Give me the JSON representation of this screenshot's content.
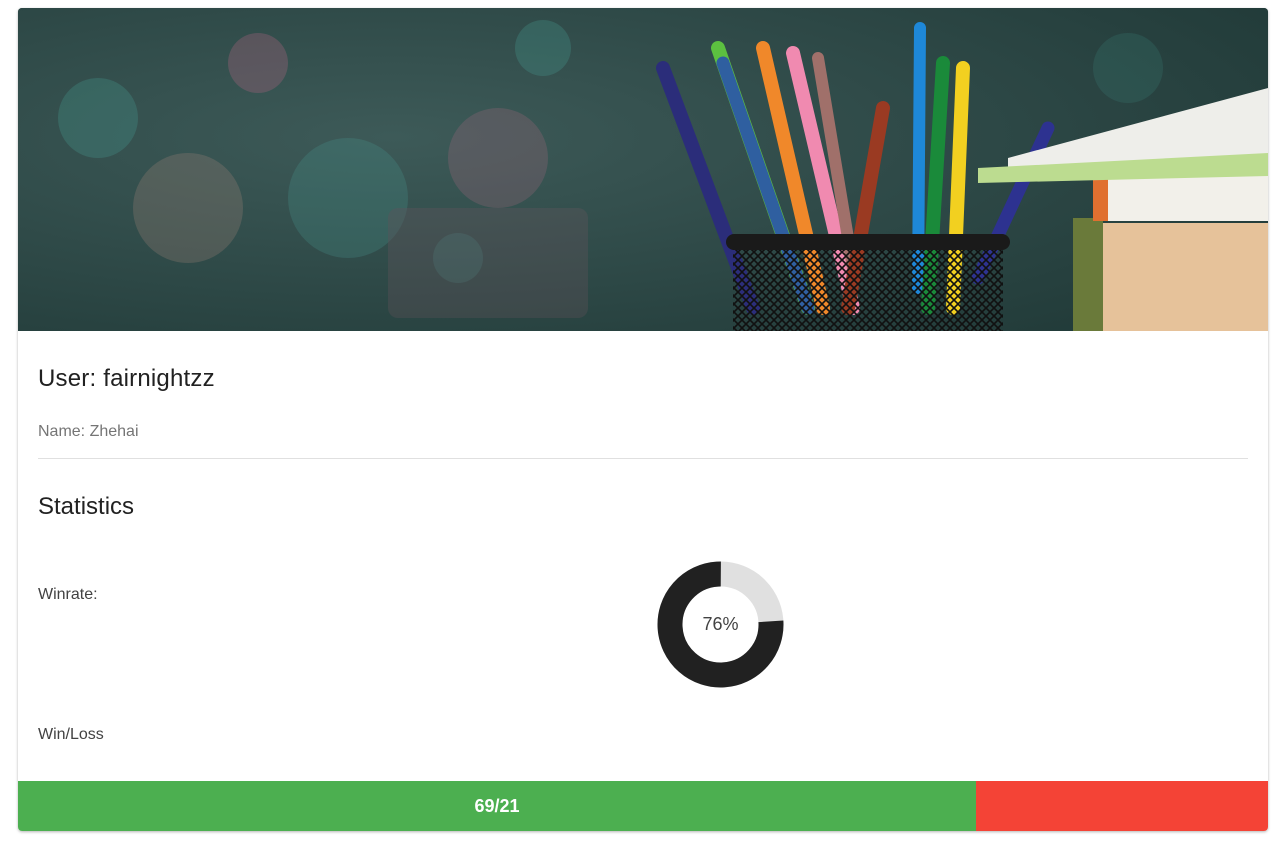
{
  "hero": {
    "image": "classroom-pencils-banner"
  },
  "profile": {
    "user_title": "User: fairnightzz",
    "name_line": "Name: Zhehai"
  },
  "statistics": {
    "title": "Statistics",
    "winrate_label": "Winrate:",
    "winrate_value": 76,
    "winrate_text": "76%",
    "winloss_label": "Win/Loss",
    "wins": 69,
    "losses": 21,
    "winloss_text": "69/21"
  },
  "colors": {
    "win": "#4caf50",
    "loss": "#f44336",
    "donut_filled": "#212121",
    "donut_track": "#e0e0e0"
  }
}
